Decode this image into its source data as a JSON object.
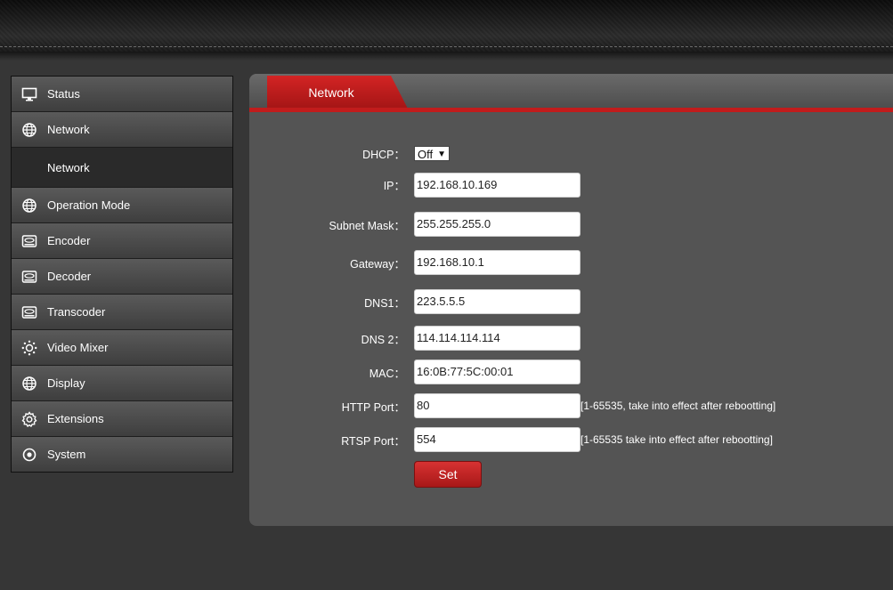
{
  "sidebar": {
    "items": [
      {
        "label": "Status",
        "icon": "monitor-icon"
      },
      {
        "label": "Network",
        "icon": "globe-icon"
      },
      {
        "label": "Network",
        "sub": true
      },
      {
        "label": "Operation Mode",
        "icon": "globe-icon"
      },
      {
        "label": "Encoder",
        "icon": "drive-icon"
      },
      {
        "label": "Decoder",
        "icon": "drive-icon"
      },
      {
        "label": "Transcoder",
        "icon": "drive-icon"
      },
      {
        "label": "Video Mixer",
        "icon": "sun-gear-icon"
      },
      {
        "label": "Display",
        "icon": "globe-icon"
      },
      {
        "label": "Extensions",
        "icon": "gear-icon"
      },
      {
        "label": "System",
        "icon": "target-icon"
      }
    ]
  },
  "tab": {
    "label": "Network"
  },
  "form": {
    "dhcp": {
      "label": "DHCP：",
      "value": "Off",
      "options": [
        "Off"
      ]
    },
    "ip": {
      "label": "IP：",
      "value": "192.168.10.169"
    },
    "subnet": {
      "label": "Subnet Mask：",
      "value": "255.255.255.0"
    },
    "gateway": {
      "label": "Gateway：",
      "value": "192.168.10.1"
    },
    "dns1": {
      "label": "DNS1：",
      "value": "223.5.5.5"
    },
    "dns2": {
      "label": "DNS 2：",
      "value": "114.114.114.114"
    },
    "mac": {
      "label": "MAC：",
      "value": "16:0B:77:5C:00:01"
    },
    "http_port": {
      "label": "HTTP Port：",
      "value": "80",
      "hint": "[1-65535, take into effect after rebootting]"
    },
    "rtsp_port": {
      "label": "RTSP Port：",
      "value": "554",
      "hint": "[1-65535 take into effect after rebootting]"
    }
  },
  "set_button": {
    "label": "Set"
  },
  "colors": {
    "accent": "#c11c1c",
    "panel": "#545454",
    "background": "#363636"
  }
}
